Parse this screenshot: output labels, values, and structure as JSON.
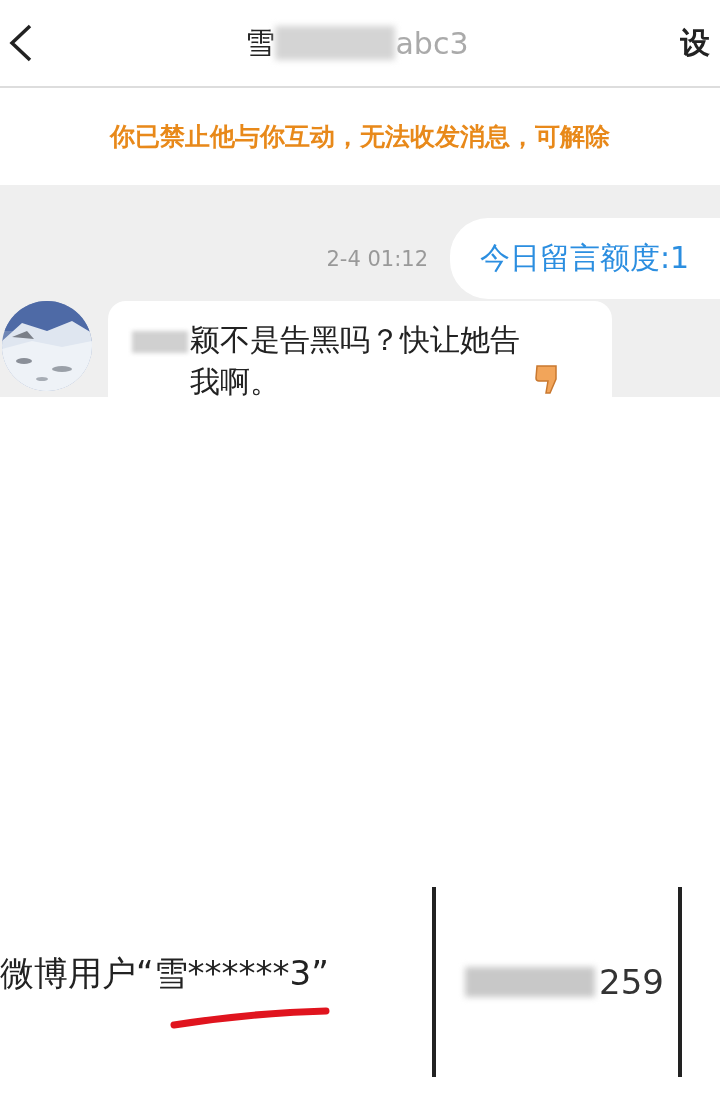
{
  "header": {
    "title_visible": "雪",
    "title_tail": "abc3",
    "settings": "设"
  },
  "banner": {
    "text": "你已禁止他与你互动，无法收发消息，可解除"
  },
  "messages": [
    {
      "kind": "outgoing",
      "time": "2-4 01:12",
      "text": "今日留言额度:1"
    },
    {
      "kind": "incoming",
      "text": "颖不是告黑吗？快让她告我啊。"
    }
  ],
  "document": {
    "user_label": "微博用户“雪******3”",
    "id_tail": "259"
  }
}
